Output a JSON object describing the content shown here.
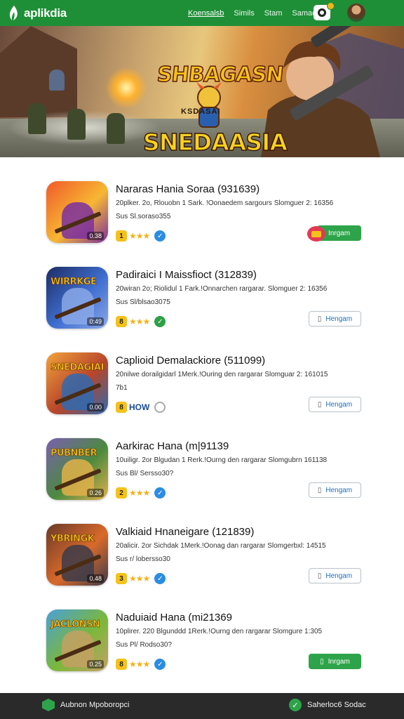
{
  "header": {
    "brand": "aplikdia",
    "nav": [
      "Koensalsb",
      "Simils",
      "Stam",
      "Samaes"
    ]
  },
  "banner": {
    "title_top": "SHBAGASN",
    "subtitle": "KSDASAI",
    "title_main": "SNEDAASIA"
  },
  "apps": [
    {
      "title": "Nararas Hania Soraa (931639)",
      "meta": "20plker. 2o, Rlouobn 1 Sark. !Oonaedem sargours Slomguer 2: 16356",
      "meta2": "Sus Sl.soraso355",
      "icon_label": "",
      "version": "0.38",
      "badge": "1",
      "stars": "★★★",
      "verify": "blue",
      "button_label": "Inrgam",
      "button_style": "solid",
      "recommended": true,
      "icon_colors": [
        "#f05a2b",
        "#f7b733",
        "#7b2fa0"
      ]
    },
    {
      "title": "Padiraici I Maissfioct (312839)",
      "meta": "20wiran 2o; Riolidul 1 Fark.!Onnarchen rargarar. Slomguer 2: 16356",
      "meta2": "Sus Sl/blsao3075",
      "icon_label": "WIRRKGE",
      "version": "0:49",
      "badge": "8",
      "stars": "★★★",
      "verify": "green",
      "button_label": "Hengam",
      "button_style": "outline",
      "recommended": false,
      "icon_colors": [
        "#1d2c64",
        "#3f6fd1",
        "#8ba8e8"
      ]
    },
    {
      "title": "Caplioid Demalackiore (511099)",
      "meta": "20nilwe dorailgidarl 1Merk.!Ouring den rargarar Slomguar 2: 161015",
      "meta2": "7b1",
      "icon_label": "SNEDAGIAI",
      "version": "0.00",
      "badge": "8",
      "stars": "HOW",
      "verify": "grey",
      "button_label": "Hengam",
      "button_style": "outline",
      "recommended": false,
      "icon_colors": [
        "#f2a23b",
        "#b7452a",
        "#2f6ab0"
      ]
    },
    {
      "title": "Aarkirac Hana (m|91139",
      "meta": "10uiligr. 2or Blgudan 1 Rerk.!Ourng den rargarar Slomgubrn 161138",
      "meta2": "Sus Bl/ Sersso30?",
      "icon_label": "PUBNBER",
      "version": "0.26",
      "badge": "2",
      "stars": "★★★",
      "verify": "blue",
      "button_label": "Hengam",
      "button_style": "outline",
      "recommended": false,
      "icon_colors": [
        "#7a5fb0",
        "#4c8a3e",
        "#e2b04a"
      ]
    },
    {
      "title": "Valkiaid Hnaneigare (121839)",
      "meta": "20alicir. 2or Sichdak 1Merk.!Oonag dan rargarar Slomgerbxl: 14515",
      "meta2": "Sus r/ lobersso30",
      "icon_label": "YBRINGK",
      "version": "0.48",
      "badge": "3",
      "stars": "★★★",
      "verify": "blue",
      "button_label": "Hengam",
      "button_style": "outline",
      "recommended": false,
      "icon_colors": [
        "#6a3a2a",
        "#d96a2a",
        "#3b3b4a"
      ]
    },
    {
      "title": "Naduiaid Hana (mi21369",
      "meta": "10plirer. 220 Blgunddd 1Rerk.!Ourng den rargarar Slomgure 1:305",
      "meta2": "Sus Pl/ Rodso30?",
      "icon_label": "JACLONSN",
      "version": "0.25",
      "badge": "8",
      "stars": "★★★",
      "verify": "blue",
      "button_label": "Inrgam",
      "button_style": "solid",
      "recommended": false,
      "icon_colors": [
        "#4aa0d8",
        "#7ab83a",
        "#c4a064"
      ]
    }
  ],
  "footer": {
    "left_label": "Aubnon Mpoboropci",
    "right_label": "Saherloc6 Sodac"
  },
  "colors": {
    "header_green": "#1f8f37",
    "button_green": "#2ea44a",
    "link_blue": "#1e6fb8",
    "footer_dark": "#2a2a2a"
  }
}
